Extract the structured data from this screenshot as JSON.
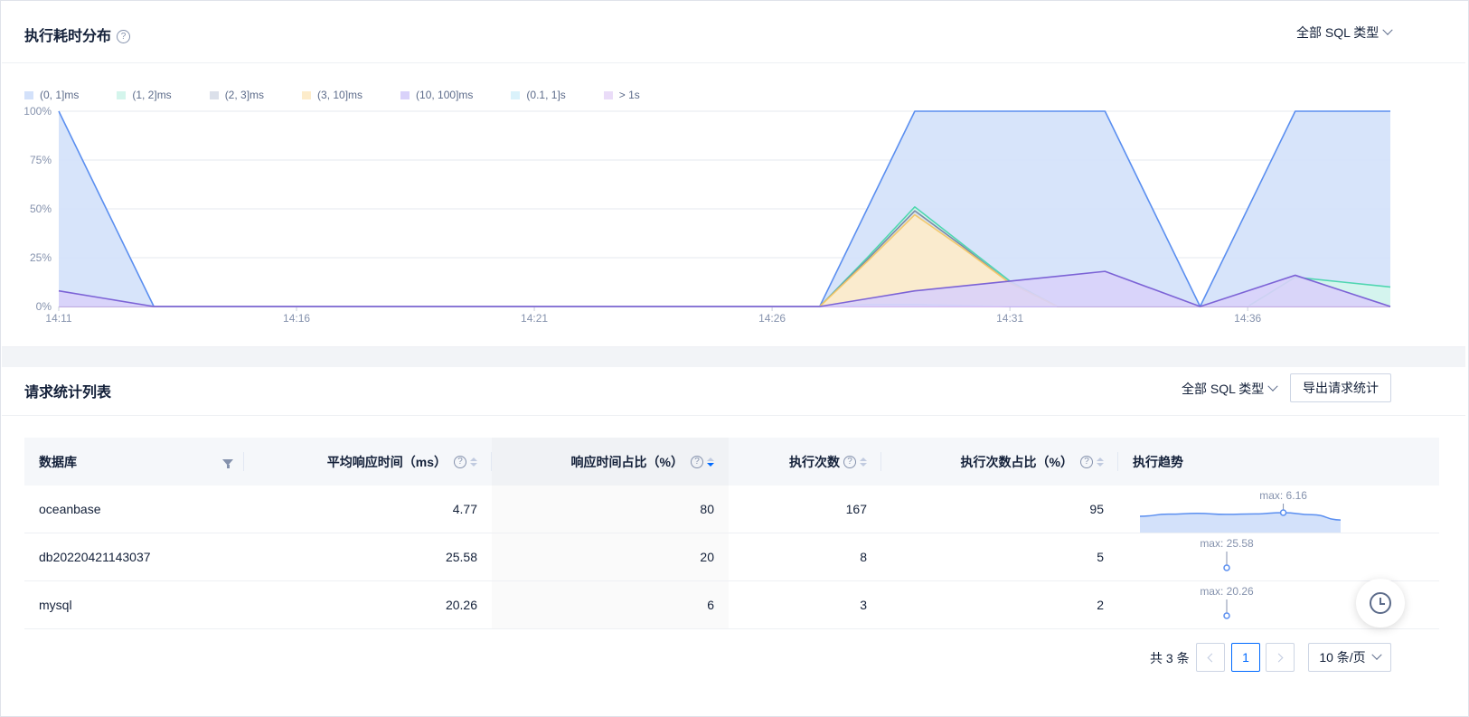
{
  "distribution": {
    "title": "执行耗时分布",
    "help_icon": "?",
    "sql_type_dropdown": "全部 SQL 类型"
  },
  "chart_data": {
    "type": "area",
    "x": [
      "14:11",
      "14:12",
      "14:13",
      "14:14",
      "14:15",
      "14:16",
      "14:17",
      "14:18",
      "14:19",
      "14:20",
      "14:21",
      "14:22",
      "14:23",
      "14:24",
      "14:25",
      "14:26",
      "14:27",
      "14:28",
      "14:29",
      "14:30",
      "14:31",
      "14:32",
      "14:33",
      "14:34",
      "14:35",
      "14:36",
      "14:37",
      "14:38",
      "14:39"
    ],
    "xticks": [
      "14:11",
      "14:16",
      "14:21",
      "14:26",
      "14:31",
      "14:36"
    ],
    "yticks": [
      "0%",
      "25%",
      "50%",
      "75%",
      "100%"
    ],
    "ylim": [
      0,
      100
    ],
    "stacked": false,
    "legend_position": "top-left",
    "series": [
      {
        "name": "(0, 1]ms",
        "color": "#5b8ff0",
        "fill": "#d3e1fa",
        "values": [
          100,
          50,
          0,
          0,
          0,
          0,
          0,
          0,
          0,
          0,
          0,
          0,
          0,
          0,
          0,
          0,
          0,
          50,
          100,
          100,
          100,
          100,
          100,
          50,
          0,
          50,
          100,
          100,
          100
        ]
      },
      {
        "name": "(1, 2]ms",
        "color": "#4fd6b0",
        "fill": "#d4f5ec",
        "values": [
          0,
          0,
          0,
          0,
          0,
          0,
          0,
          0,
          0,
          0,
          0,
          0,
          0,
          0,
          0,
          0,
          0,
          25,
          51,
          32,
          13,
          0,
          0,
          0,
          0,
          0,
          15,
          12.5,
          10
        ]
      },
      {
        "name": "(2, 3]ms",
        "color": "#7a8ba8",
        "fill": "#dbe0ea",
        "values": [
          0,
          0,
          0,
          0,
          0,
          0,
          0,
          0,
          0,
          0,
          0,
          0,
          0,
          0,
          0,
          0,
          0,
          24,
          49,
          31,
          12,
          0,
          0,
          0,
          0,
          0,
          0,
          0,
          0
        ]
      },
      {
        "name": "(3, 10]ms",
        "color": "#f3c96b",
        "fill": "#fdeccb",
        "values": [
          0,
          0,
          0,
          0,
          0,
          0,
          0,
          0,
          0,
          0,
          0,
          0,
          0,
          0,
          0,
          0,
          0,
          23,
          47,
          30,
          12,
          0,
          0,
          0,
          0,
          0,
          0,
          0,
          0
        ]
      },
      {
        "name": "(10, 100]ms",
        "color": "#7c63d6",
        "fill": "#d9d2fa",
        "values": [
          8,
          4,
          0,
          0,
          0,
          0,
          0,
          0,
          0,
          0,
          0,
          0,
          0,
          0,
          0,
          0,
          0,
          4,
          8,
          10.5,
          13,
          15.5,
          18,
          9,
          0,
          8,
          16,
          8,
          0
        ]
      },
      {
        "name": "(0.1, 1]s",
        "color": "#8fd4f0",
        "fill": "#daf2fb",
        "values": [
          0,
          0,
          0,
          0,
          0,
          0,
          0,
          0,
          0,
          0,
          0,
          0,
          0,
          0,
          0,
          0,
          0,
          1,
          1,
          0.5,
          0,
          0,
          0,
          0,
          0,
          0,
          0,
          0,
          0
        ]
      },
      {
        "name": "> 1s",
        "color": "#c6a3ea",
        "fill": "#eadcf8",
        "values": [
          0,
          0,
          0,
          0,
          0,
          0,
          0,
          0,
          0,
          0,
          0,
          0,
          0,
          0,
          0,
          0,
          0,
          0,
          0,
          0,
          0,
          0,
          0,
          0,
          0,
          0,
          0,
          0,
          0
        ]
      }
    ]
  },
  "requests": {
    "title": "请求统计列表",
    "sql_type_dropdown": "全部 SQL 类型",
    "export_button": "导出请求统计",
    "columns": {
      "db": "数据库",
      "avg": "平均响应时间（ms）",
      "ratio": "响应时间占比（%）",
      "count": "执行次数",
      "count_ratio": "执行次数占比（%）",
      "trend": "执行趋势"
    },
    "rows": [
      {
        "db": "oceanbase",
        "avg": "4.77",
        "ratio": "80",
        "count": "167",
        "count_ratio": "95",
        "trend_label": "max: 6.16",
        "trend": [
          4.8,
          5.6,
          5.9,
          5.5,
          5.7,
          6.16,
          5.4,
          3.4
        ]
      },
      {
        "db": "db20220421143037",
        "avg": "25.58",
        "ratio": "20",
        "count": "8",
        "count_ratio": "5",
        "trend_label": "max: 25.58",
        "trend": [
          25.58
        ]
      },
      {
        "db": "mysql",
        "avg": "20.26",
        "ratio": "6",
        "count": "3",
        "count_ratio": "2",
        "trend_label": "max: 20.26",
        "trend": [
          20.26
        ]
      }
    ]
  },
  "pagination": {
    "total": "共 3 条",
    "current_page": "1",
    "page_size": "10 条/页"
  },
  "icons": {
    "help": "question-circle-icon",
    "filter": "funnel-icon",
    "history": "clock-icon"
  }
}
